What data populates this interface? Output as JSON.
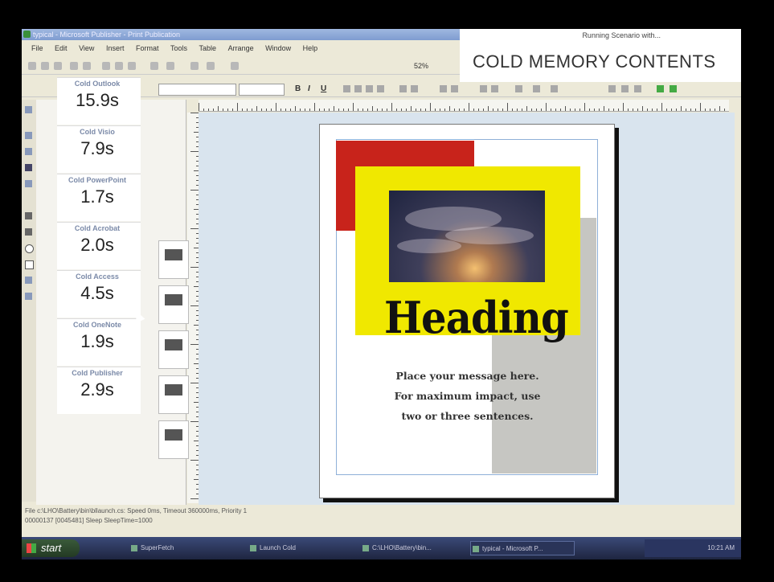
{
  "window": {
    "title": "typical - Microsoft Publisher - Print Publication",
    "menu": [
      "File",
      "Edit",
      "View",
      "Insert",
      "Format",
      "Tools",
      "Table",
      "Arrange",
      "Window",
      "Help"
    ],
    "zoom": "52%"
  },
  "overlay": {
    "subtitle": "Running Scenario with...",
    "heading": "COLD MEMORY CONTENTS"
  },
  "timers": [
    {
      "label": "Cold Outlook",
      "value": "15.9s"
    },
    {
      "label": "Cold Visio",
      "value": "7.9s"
    },
    {
      "label": "Cold PowerPoint",
      "value": "1.7s"
    },
    {
      "label": "Cold Acrobat",
      "value": "2.0s"
    },
    {
      "label": "Cold Access",
      "value": "4.5s"
    },
    {
      "label": "Cold OneNote",
      "value": "1.9s"
    },
    {
      "label": "Cold Publisher",
      "value": "2.9s"
    }
  ],
  "publication": {
    "heading": "Heading",
    "message_lines": [
      "Place your message here.",
      "For maximum impact, use",
      "two or three sentences."
    ]
  },
  "status": {
    "line1": "File c:\\LHO\\Battery\\bin\\bllaunch.cs: Speed 0ms, Timeout 360000ms, Priority 1",
    "line2": "00000137 [0045481] Sleep SleepTime=1000"
  },
  "taskbar": {
    "start": "start",
    "tasks": [
      "SuperFetch",
      "Launch Cold",
      "C:\\LHO\\Battery\\bin...",
      "typical - Microsoft P..."
    ],
    "clock": "10:21 AM"
  }
}
